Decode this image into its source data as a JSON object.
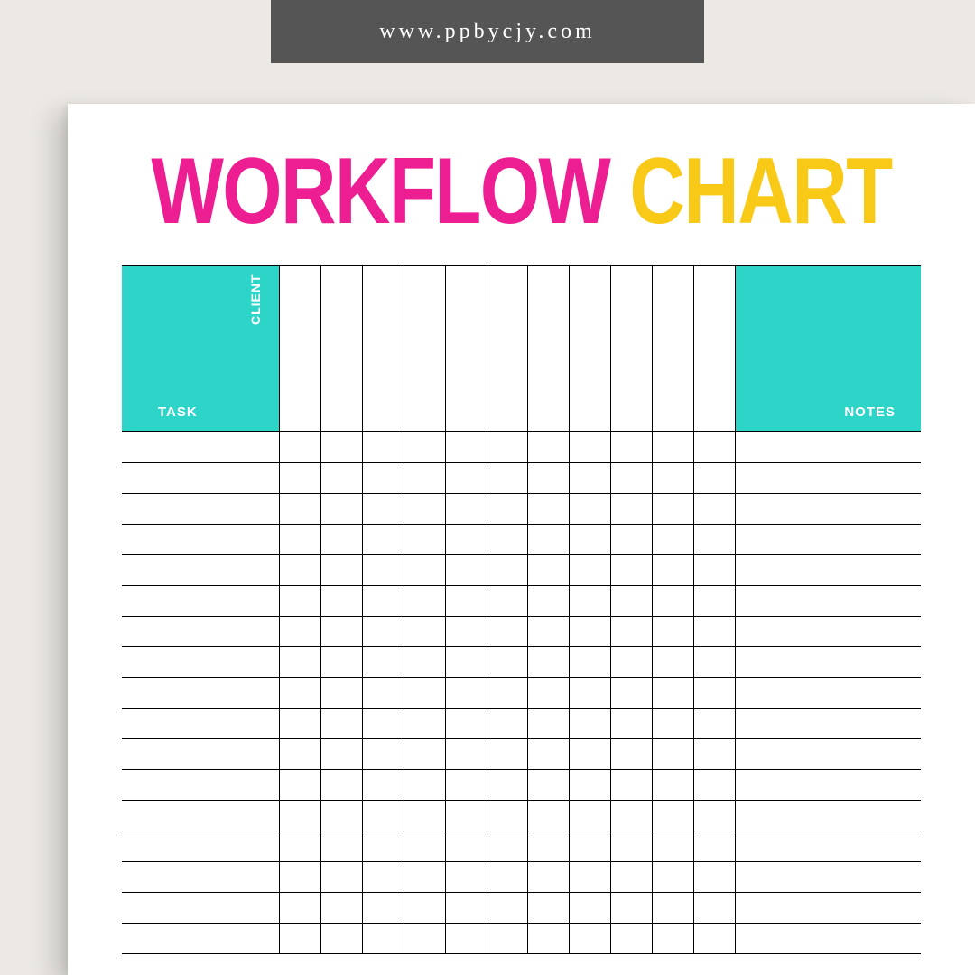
{
  "banner": {
    "url_text": "www.ppbycjy.com"
  },
  "title": {
    "word1": "WORKFLOW",
    "word2": "CHART"
  },
  "headers": {
    "client": "CLIENT",
    "task": "TASK",
    "notes": "NOTES"
  },
  "grid": {
    "middle_columns": 11,
    "body_rows": 17
  },
  "colors": {
    "banner_bg": "#555555",
    "accent_teal": "#2dd4c8",
    "title_pink": "#ed1e91",
    "title_yellow": "#f9c917",
    "page_bg": "#ece9e4"
  }
}
